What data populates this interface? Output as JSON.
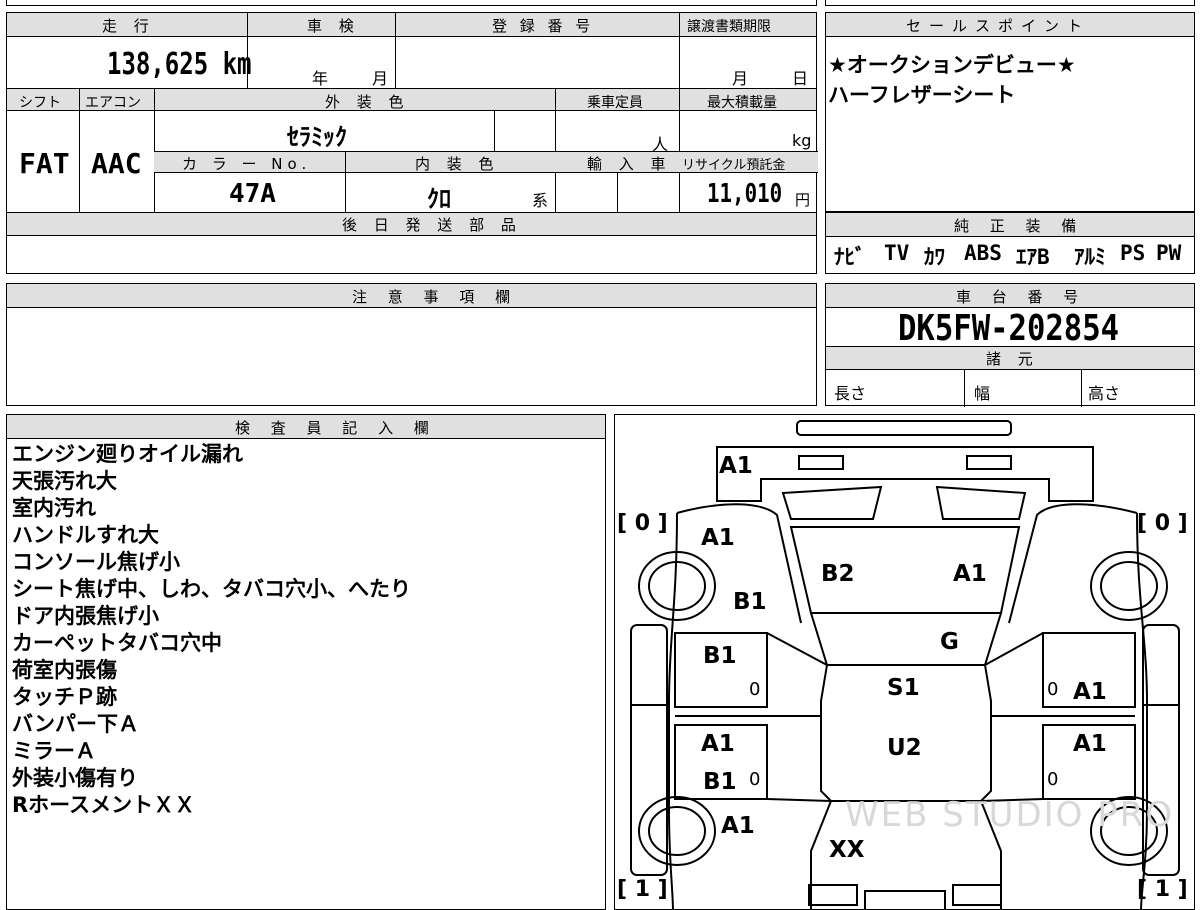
{
  "top_table": {
    "mileage_label": "走 行",
    "mileage_value": "138,625 km",
    "inspection_label": "車 検",
    "year_unit": "年",
    "month_unit": "月",
    "registration_label": "登 録 番 号",
    "transfer_label": "譲渡書類期限",
    "transfer_month": "月",
    "transfer_day": "日",
    "shift_label": "シフト",
    "shift_value": "FAT",
    "ac_label": "エアコン",
    "ac_value": "AAC",
    "exterior_label": "外 装 色",
    "exterior_value": "ｾﾗﾐｯｸ",
    "capacity_label": "乗車定員",
    "capacity_unit": "人",
    "maxload_label": "最大積載量",
    "maxload_unit": "kg",
    "color_no_label": "カ ラ ー No.",
    "color_no_value": "47A",
    "interior_label": "内 装 色",
    "interior_value": "ｸﾛ",
    "interior_suffix": "系",
    "import_label": "輸 入 車",
    "recycle_label": "リサイクル預託金",
    "recycle_value": "11,010",
    "recycle_unit": "円",
    "parts_label": "後 日 発 送 部 品"
  },
  "sales_point": {
    "label": "セールスポイント",
    "lines": [
      "★オークションデビュー★",
      "ハーフレザーシート"
    ]
  },
  "genuine_equipment": {
    "label": "純 正 装 備",
    "items": [
      "ﾅﾋﾞ",
      "TV",
      "ｶﾜ",
      "ABS",
      "ｴｱB",
      "ｱﾙﾐ",
      "PS",
      "PW"
    ]
  },
  "caution": {
    "label": "注 意 事 項 欄"
  },
  "chassis": {
    "label": "車 台 番 号",
    "value": "DK5FW-202854",
    "spec_label": "諸 元",
    "length_label": "長さ",
    "width_label": "幅",
    "height_label": "高さ"
  },
  "inspector": {
    "label": "検 査 員 記 入 欄",
    "notes": [
      "エンジン廻りオイル漏れ",
      "天張汚れ大",
      "室内汚れ",
      "ハンドルすれ大",
      "コンソール焦げ小",
      "シート焦げ中、しわ、タバコ穴小、へたり",
      "ドア内張焦げ小",
      "カーペットタバコ穴中",
      "荷室内張傷",
      "タッチＰ跡",
      "バンパー下Ａ",
      "ミラーＡ",
      "外装小傷有り",
      "RホースメントＸＸ"
    ]
  },
  "diagram": {
    "tire_tl": "[ 0 ]",
    "tire_tr": "[ 0 ]",
    "tire_bl": "[ 1 ]",
    "tire_br": "[ 1 ]",
    "bumper_front": "A1",
    "fender_fl": "A1",
    "fender_fl_lower": "B1",
    "hood_left": "B2",
    "hood_right": "A1",
    "windshield": "G",
    "door_fl": "B1",
    "door_fl_zero": "0",
    "door_fr_zero": "0",
    "door_fr": "A1",
    "roof_front": "S1",
    "roof_rear": "U2",
    "door_rl": "A1",
    "door_rl_lower": "B1",
    "door_rl_zero": "0",
    "door_rr": "A1",
    "door_rr_zero": "0",
    "quarter_rl": "A1",
    "trunk": "XX",
    "watermark": "WEB STUDIO PRO"
  }
}
